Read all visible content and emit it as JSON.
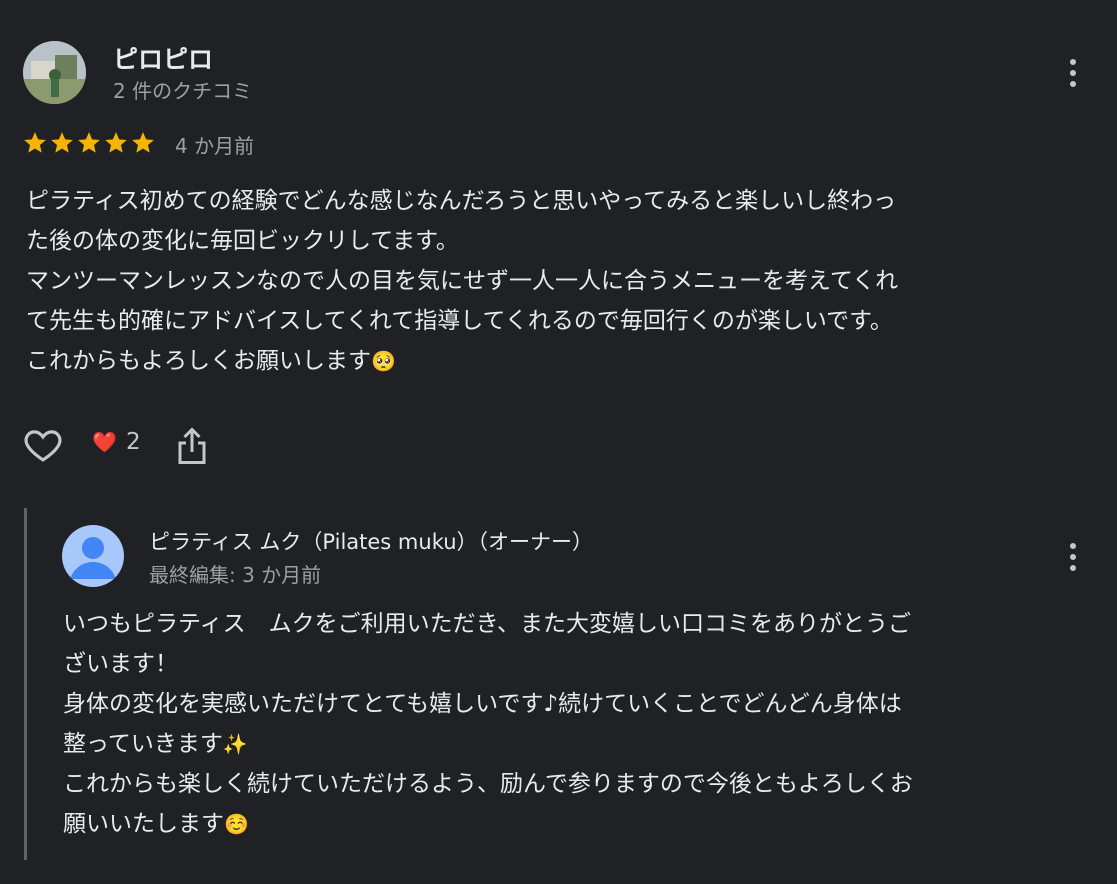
{
  "review": {
    "reviewer_name": "ピロピロ",
    "review_count": "2 件のクチコミ",
    "rating": 5,
    "date": "4 か月前",
    "text_lines": [
      "ピラティス初めての経験でどんな感じなんだろうと思いやってみると楽しいし終わっ",
      "た後の体の変化に毎回ビックリしてます。",
      "マンツーマンレッスンなので人の目を気にせず一人一人に合うメニューを考えてくれ",
      "て先生も的確にアドバイスしてくれて指導してくれるので毎回行くのが楽しいです。",
      "これからもよろしくお願いします"
    ],
    "text_end_emoji": "🥺",
    "reaction_emoji": "❤️",
    "reaction_count": "2"
  },
  "reply": {
    "owner_name": "ピラティス ムク（Pilates muku）（オーナー）",
    "date": "最終編集: 3 か月前",
    "text_lines": [
      "いつもピラティス　ムクをご利用いただき、また大変嬉しい口コミをありがとうご",
      "ざいます！",
      "身体の変化を実感いただけてとても嬉しいです♪続けていくことでどんどん身体は",
      "整っていきます",
      "これからも楽しく続けていただけるよう、励んで参りますので今後ともよろしくお",
      "願いいたします"
    ],
    "line4_emoji": "✨",
    "line6_emoji": "☺️"
  },
  "icons": {
    "more": "more-vert-icon",
    "like": "heart-outline-icon",
    "share": "share-icon",
    "star": "star-icon",
    "owner_avatar": "person-icon"
  },
  "colors": {
    "background": "#202124",
    "star": "#f4b400",
    "secondary_text": "#9aa0a6",
    "owner_avatar": "#a8c7fa"
  }
}
